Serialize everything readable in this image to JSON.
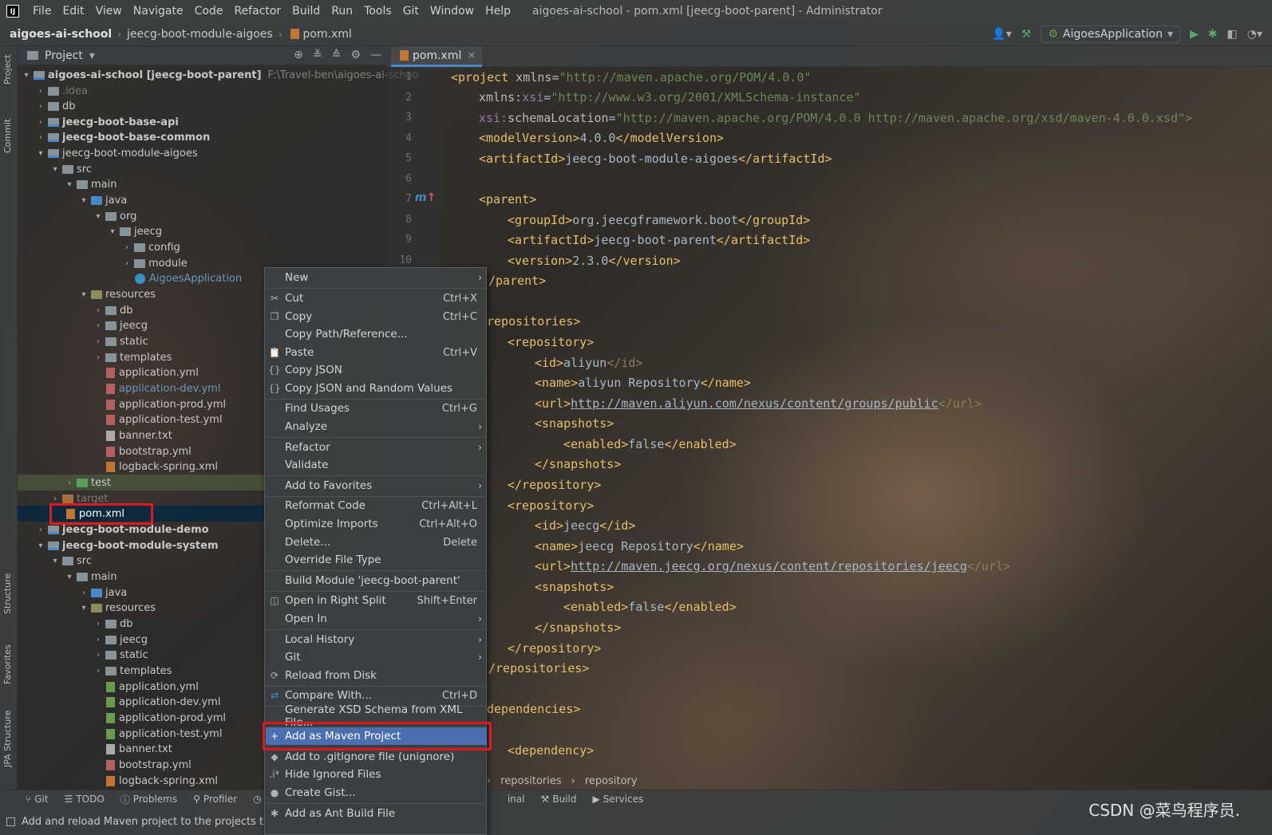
{
  "menubar": {
    "items": [
      "File",
      "Edit",
      "View",
      "Navigate",
      "Code",
      "Refactor",
      "Build",
      "Run",
      "Tools",
      "Git",
      "Window",
      "Help"
    ],
    "window_title": "aigoes-ai-school - pom.xml [jeecg-boot-parent] - Administrator"
  },
  "breadcrumb": {
    "items": [
      "aigoes-ai-school",
      "jeecg-boot-module-aigoes",
      "pom.xml"
    ]
  },
  "run_config": {
    "label": "AigoesApplication"
  },
  "left_strip": {
    "tabs": [
      "Project",
      "Commit",
      "Structure",
      "Favorites",
      "JPA Structure"
    ]
  },
  "project_panel": {
    "title": "Project",
    "tree": [
      {
        "label": "aigoes-ai-school [jeecg-boot-parent]",
        "path": "F:\\Travel-ben\\aigoes-ai-schoo"
      },
      {
        "label": ".idea"
      },
      {
        "label": "db"
      },
      {
        "label": "jeecg-boot-base-api"
      },
      {
        "label": "jeecg-boot-base-common"
      },
      {
        "label": "jeecg-boot-module-aigoes"
      },
      {
        "label": "src"
      },
      {
        "label": "main"
      },
      {
        "label": "java"
      },
      {
        "label": "org"
      },
      {
        "label": "jeecg"
      },
      {
        "label": "config"
      },
      {
        "label": "module"
      },
      {
        "label": "AigoesApplication"
      },
      {
        "label": "resources"
      },
      {
        "label": "db"
      },
      {
        "label": "jeecg"
      },
      {
        "label": "static"
      },
      {
        "label": "templates"
      },
      {
        "label": "application.yml"
      },
      {
        "label": "application-dev.yml"
      },
      {
        "label": "application-prod.yml"
      },
      {
        "label": "application-test.yml"
      },
      {
        "label": "banner.txt"
      },
      {
        "label": "bootstrap.yml"
      },
      {
        "label": "logback-spring.xml"
      },
      {
        "label": "test"
      },
      {
        "label": "target"
      },
      {
        "label": "pom.xml"
      },
      {
        "label": "jeecg-boot-module-demo"
      },
      {
        "label": "jeecg-boot-module-system"
      },
      {
        "label": "src"
      },
      {
        "label": "main"
      },
      {
        "label": "java"
      },
      {
        "label": "resources"
      },
      {
        "label": "db"
      },
      {
        "label": "jeecg"
      },
      {
        "label": "static"
      },
      {
        "label": "templates"
      },
      {
        "label": "application.yml"
      },
      {
        "label": "application-dev.yml"
      },
      {
        "label": "application-prod.yml"
      },
      {
        "label": "application-test.yml"
      },
      {
        "label": "banner.txt"
      },
      {
        "label": "bootstrap.yml"
      },
      {
        "label": "logback-spring.xml"
      }
    ]
  },
  "editor": {
    "tab": "pom.xml",
    "line_numbers": [
      "1",
      "2",
      "3",
      "4",
      "5",
      "6",
      "7",
      "8",
      "9",
      "10"
    ],
    "code": {
      "l1": {
        "tag": "<project ",
        "attr": "xmlns",
        "eq": "=",
        "val": "\"http://maven.apache.org/POM/4.0.0\""
      },
      "l2": {
        "ns": "xmlns:",
        "attr": "xsi",
        "eq": "=",
        "val": "\"http://www.w3.org/2001/XMLSchema-instance\""
      },
      "l3": {
        "ns": "xsi:",
        "attr": "schemaLocation",
        "eq": "=",
        "val": "\"http://maven.apache.org/POM/4.0.0 http://maven.apache.org/xsd/maven-4.0.0.xsd\">"
      },
      "l4": {
        "open": "<modelVersion>",
        "text": "4.0.0",
        "close": "</modelVersion>"
      },
      "l5": {
        "open": "<artifactId>",
        "text": "jeecg-boot-module-aigoes",
        "close": "</artifactId>"
      },
      "l7": {
        "open": "<parent>"
      },
      "l8": {
        "open": "<groupId>",
        "text": "org.jeecgframework.boot",
        "close": "</groupId>"
      },
      "l9": {
        "open": "<artifactId>",
        "text": "jeecg-boot-parent",
        "close": "</artifactId>"
      },
      "l10": {
        "open": "<version>",
        "text": "2.3.0",
        "close": "</version>"
      },
      "l11": {
        "close": "/parent>"
      },
      "l13": {
        "open": "repositories>"
      },
      "l14": {
        "open": "<repository>"
      },
      "l15": {
        "open": "<id>",
        "text": "aliyun",
        "close": "</id>"
      },
      "l16": {
        "open": "<name>",
        "text": "aliyun Repository",
        "close": "</name>"
      },
      "l17": {
        "open": "<url>",
        "text": "http://maven.aliyun.com/nexus/content/groups/public",
        "close": "</url>"
      },
      "l18": {
        "open": "<snapshots>"
      },
      "l19": {
        "open": "<enabled>",
        "text": "false",
        "close": "</enabled>"
      },
      "l20": {
        "close": "</snapshots>"
      },
      "l21": {
        "close": "</repository>"
      },
      "l22": {
        "open": "<repository>"
      },
      "l23": {
        "open": "<id>",
        "text": "jeecg",
        "close": "</id>"
      },
      "l24": {
        "open": "<name>",
        "text": "jeecg Repository",
        "close": "</name>"
      },
      "l25": {
        "open": "<url>",
        "text": "http://maven.jeecg.org/nexus/content/repositories/jeecg",
        "close": "</url>"
      },
      "l26": {
        "open": "<snapshots>"
      },
      "l27": {
        "open": "<enabled>",
        "text": "false",
        "close": "</enabled>"
      },
      "l28": {
        "close": "</snapshots>"
      },
      "l29": {
        "close": "</repository>"
      },
      "l30": {
        "close": "/repositories>"
      },
      "l32": {
        "open": "dependencies>"
      },
      "l34": {
        "open": "<dependency>"
      }
    },
    "breadcrumbs": [
      "repositories",
      "repository"
    ]
  },
  "context_menu": {
    "items": [
      {
        "label": "New",
        "submenu": true
      },
      {
        "label": "Cut",
        "shortcut": "Ctrl+X",
        "icon": "scissors-icon"
      },
      {
        "label": "Copy",
        "shortcut": "Ctrl+C",
        "icon": "copy-icon"
      },
      {
        "label": "Copy Path/Reference..."
      },
      {
        "label": "Paste",
        "shortcut": "Ctrl+V",
        "icon": "paste-icon"
      },
      {
        "label": "Copy JSON",
        "icon": "braces-icon"
      },
      {
        "label": "Copy JSON and Random Values",
        "icon": "braces-icon"
      },
      {
        "label": "Find Usages",
        "shortcut": "Ctrl+G"
      },
      {
        "label": "Analyze",
        "submenu": true
      },
      {
        "label": "Refactor",
        "submenu": true
      },
      {
        "label": "Validate"
      },
      {
        "label": "Add to Favorites",
        "submenu": true
      },
      {
        "label": "Reformat Code",
        "shortcut": "Ctrl+Alt+L"
      },
      {
        "label": "Optimize Imports",
        "shortcut": "Ctrl+Alt+O"
      },
      {
        "label": "Delete...",
        "shortcut": "Delete"
      },
      {
        "label": "Override File Type"
      },
      {
        "label": "Build Module 'jeecg-boot-parent'"
      },
      {
        "label": "Open in Right Split",
        "shortcut": "Shift+Enter",
        "icon": "split-icon"
      },
      {
        "label": "Open In",
        "submenu": true
      },
      {
        "label": "Local History",
        "submenu": true
      },
      {
        "label": "Git",
        "submenu": true
      },
      {
        "label": "Reload from Disk",
        "icon": "reload-icon"
      },
      {
        "label": "Compare With...",
        "shortcut": "Ctrl+D",
        "icon": "compare-icon"
      },
      {
        "label": "Generate XSD Schema from XML File..."
      },
      {
        "label": "Add as Maven Project",
        "icon": "plus-icon"
      },
      {
        "label": "Add to .gitignore file (unignore)",
        "icon": "gitignore-icon"
      },
      {
        "label": "Hide Ignored Files",
        "icon": "hide-icon"
      },
      {
        "label": "Create Gist...",
        "icon": "github-icon"
      },
      {
        "label": "Add as Ant Build File",
        "icon": "ant-icon"
      }
    ]
  },
  "bottom_bar": {
    "tools": [
      "Git",
      "TODO",
      "Problems",
      "Profiler",
      "St",
      "inal",
      "Build",
      "Services"
    ]
  },
  "status_bar": {
    "text": "Add and reload Maven project to the projects tree"
  },
  "watermark": "CSDN @菜鸟程序员.",
  "colors": {
    "accent": "#4b6eaf",
    "highlight_box": "#e0191c",
    "selection": "#0d293e"
  }
}
